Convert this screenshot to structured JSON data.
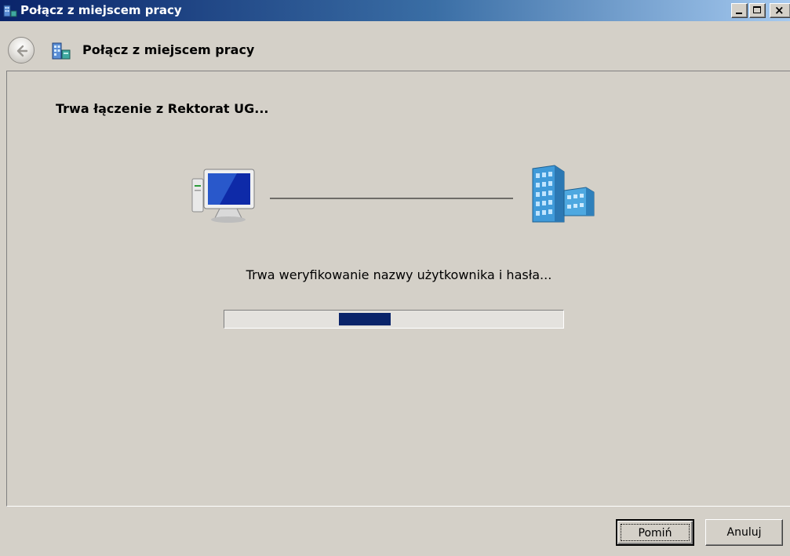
{
  "window": {
    "title": "Połącz z miejscem pracy",
    "icons": {
      "app": "workplace-network-icon",
      "minimize": "minimize-icon",
      "maximize": "maximize-icon",
      "close": "close-icon"
    }
  },
  "nav": {
    "title": "Połącz z miejscem pracy",
    "back_icon": "back-arrow-icon",
    "page_icon": "workplace-network-icon"
  },
  "content": {
    "heading": "Trwa łączenie z Rektorat UG...",
    "status": "Trwa weryfikowanie nazwy użytkownika i hasła...",
    "local_icon": "computer-icon",
    "remote_icon": "office-building-icon",
    "progress": {
      "mode": "indeterminate",
      "fill_color": "#0a246a"
    }
  },
  "buttons": {
    "skip": "Pomiń",
    "cancel": "Anuluj"
  },
  "colors": {
    "titlebar_start": "#0a246a",
    "titlebar_end": "#a6caf0",
    "face": "#d4d0c8"
  }
}
